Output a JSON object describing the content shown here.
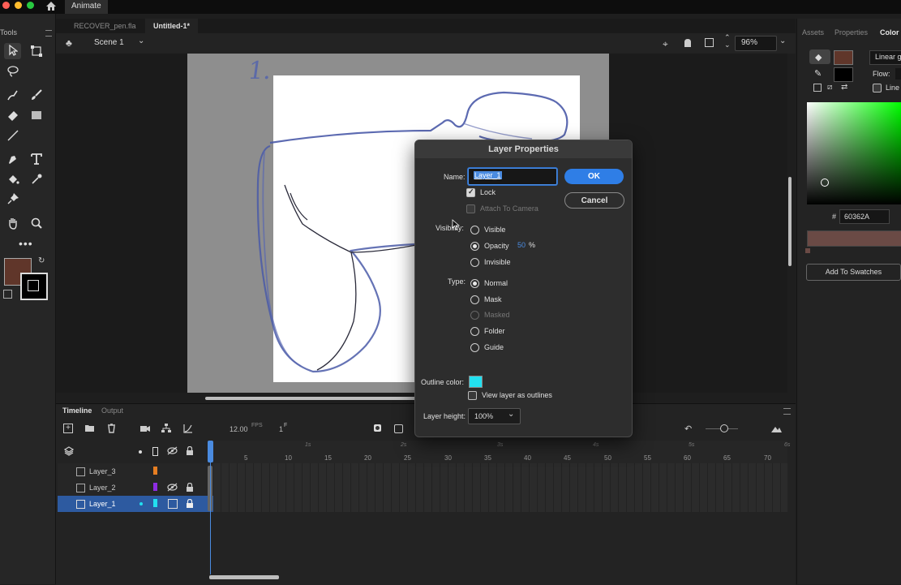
{
  "menubar": {
    "app_name": "Animate"
  },
  "tabs": [
    {
      "label": "RECOVER_pen.fla"
    },
    {
      "label": "Untitled-1*"
    }
  ],
  "tools_panel": {
    "label": "Tools"
  },
  "scene": {
    "name": "Scene 1",
    "zoom": "96%"
  },
  "stage": {
    "handwritten_number": "1."
  },
  "right_panel": {
    "tabs": [
      "Assets",
      "Properties",
      "Color"
    ],
    "fill_type": "Linear g",
    "flow_label": "Flow:",
    "line_label": "Line",
    "hex_prefix": "#",
    "hex_value": "60362A",
    "add_swatch_label": "Add To Swatches",
    "colors": {
      "fill": "#60362A",
      "stroke": "#000000"
    }
  },
  "timeline": {
    "tabs": [
      "Timeline",
      "Output"
    ],
    "fps": "12.00",
    "fps_unit": "FPS",
    "frame": "1",
    "frame_unit": "F",
    "second_marks": [
      "1s",
      "2s",
      "3s",
      "4s",
      "5s",
      "6s"
    ],
    "frame_marks": [
      "5",
      "10",
      "15",
      "20",
      "25",
      "30",
      "35",
      "40",
      "45",
      "50",
      "55",
      "60",
      "65",
      "70"
    ],
    "layers": [
      {
        "name": "Layer_3",
        "color": "#e67e22"
      },
      {
        "name": "Layer_2",
        "color": "#8e2de2"
      },
      {
        "name": "Layer_1",
        "color": "#22e0f0"
      }
    ]
  },
  "dialog": {
    "title": "Layer Properties",
    "name_label": "Name:",
    "name_value": "Layer_1",
    "ok_label": "OK",
    "cancel_label": "Cancel",
    "lock_label": "Lock",
    "attach_camera_label": "Attach To Camera",
    "visibility_label": "Visibility:",
    "visible_label": "Visible",
    "opacity_label": "Opacity",
    "opacity_value": "50",
    "opacity_unit": "%",
    "invisible_label": "Invisible",
    "type_label": "Type:",
    "types": [
      "Normal",
      "Mask",
      "Masked",
      "Folder",
      "Guide"
    ],
    "outline_color_label": "Outline color:",
    "outline_color": "#22e0f0",
    "view_outlines_label": "View layer as outlines",
    "layer_height_label": "Layer height:",
    "layer_height_value": "100%"
  }
}
